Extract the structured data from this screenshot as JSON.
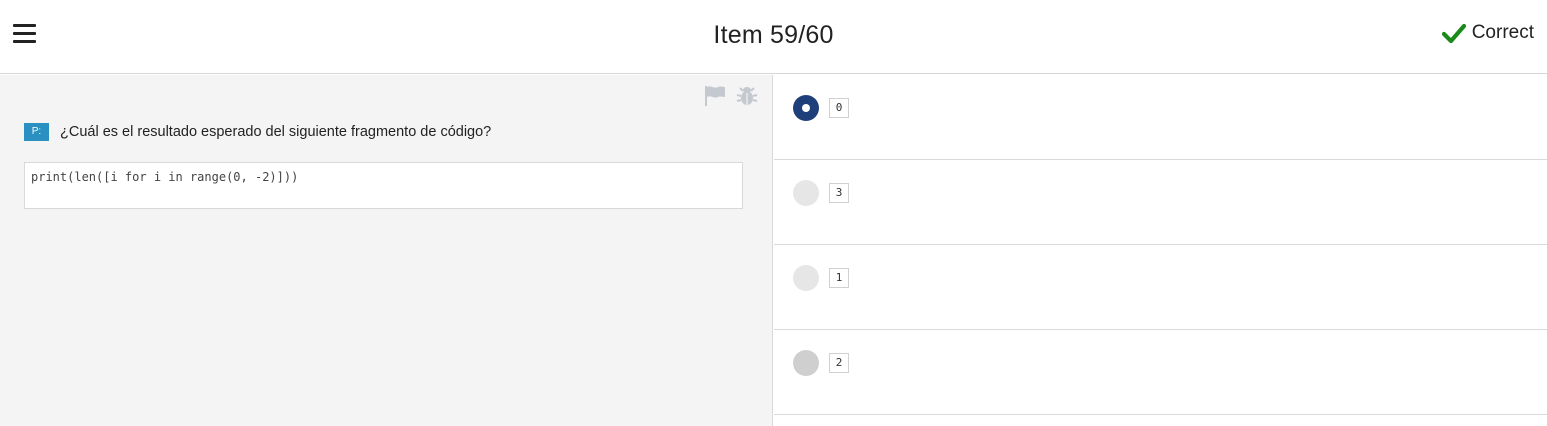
{
  "header": {
    "title": "Item 59/60",
    "status_label": "Correct",
    "status_color": "#1a8a1a"
  },
  "question": {
    "badge": "P:",
    "text": "¿Cuál es el resultado esperado del siguiente fragmento de código?",
    "code": "print(len([i for i in range(0, -2)]))",
    "tools": [
      "flag-icon",
      "bug-icon"
    ]
  },
  "answers": {
    "options": [
      {
        "label": "0",
        "selected": true
      },
      {
        "label": "3",
        "selected": false
      },
      {
        "label": "1",
        "selected": false
      },
      {
        "label": "2",
        "selected": false
      }
    ]
  },
  "colors": {
    "accent": "#1f3f7a",
    "badge": "#2a8fc1",
    "pane_bg": "#f4f4f4"
  }
}
